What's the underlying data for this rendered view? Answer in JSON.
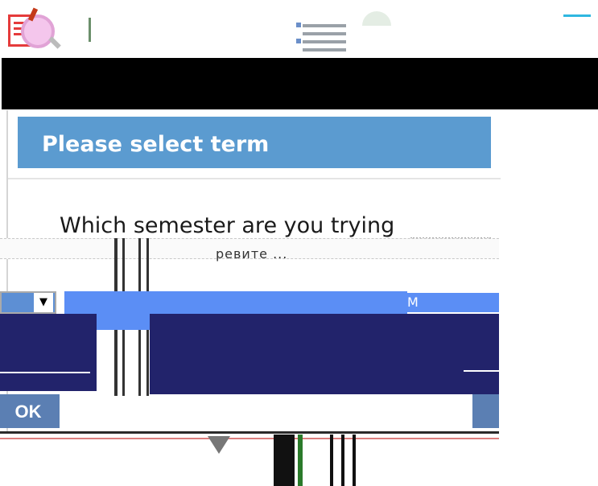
{
  "dialog": {
    "title": "Please select term",
    "question": "Which semester are you trying",
    "garbled_text": "ревите ... ",
    "ok_label": "OK",
    "select_value": "",
    "partial_label": "M"
  },
  "colors": {
    "header_blue": "#5b9bd0",
    "button_blue": "#5b7fb3",
    "navy": "#22236b",
    "bright_blue": "#5b8ef5"
  },
  "icons": [
    "document-search-icon",
    "list-icon"
  ]
}
